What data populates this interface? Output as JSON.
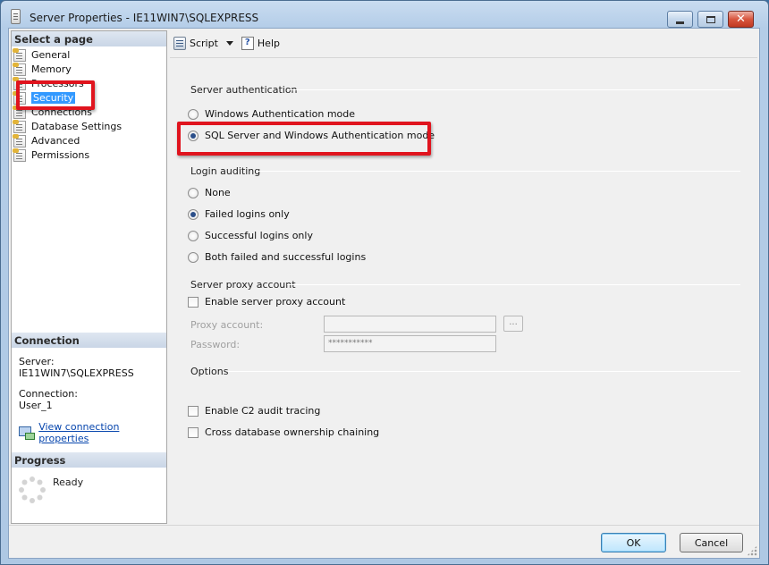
{
  "window": {
    "title": "Server Properties - IE11WIN7\\SQLEXPRESS"
  },
  "left_panel": {
    "select_page_header": "Select a page",
    "pages": [
      {
        "label": "General",
        "selected": false
      },
      {
        "label": "Memory",
        "selected": false
      },
      {
        "label": "Processors",
        "selected": false
      },
      {
        "label": "Security",
        "selected": true
      },
      {
        "label": "Connections",
        "selected": false
      },
      {
        "label": "Database Settings",
        "selected": false
      },
      {
        "label": "Advanced",
        "selected": false
      },
      {
        "label": "Permissions",
        "selected": false
      }
    ],
    "connection": {
      "header": "Connection",
      "server_label": "Server:",
      "server_value": "IE11WIN7\\SQLEXPRESS",
      "connection_label": "Connection:",
      "connection_value": "User_1",
      "link_text": "View connection properties"
    },
    "progress": {
      "header": "Progress",
      "status": "Ready"
    }
  },
  "toolbar": {
    "script_label": "Script",
    "help_label": "Help"
  },
  "server_authentication": {
    "header": "Server authentication",
    "options": [
      {
        "label": "Windows Authentication mode",
        "checked": false
      },
      {
        "label": "SQL Server and Windows Authentication mode",
        "checked": true
      }
    ]
  },
  "login_auditing": {
    "header": "Login auditing",
    "options": [
      {
        "label": "None",
        "checked": false
      },
      {
        "label": "Failed logins only",
        "checked": true
      },
      {
        "label": "Successful logins only",
        "checked": false
      },
      {
        "label": "Both failed and successful logins",
        "checked": false
      }
    ]
  },
  "server_proxy": {
    "header": "Server proxy account",
    "enable_label": "Enable server proxy account",
    "enable_checked": false,
    "proxy_account_label": "Proxy account:",
    "proxy_account_value": "",
    "password_label": "Password:",
    "password_value": "***********",
    "browse_label": "..."
  },
  "options": {
    "header": "Options",
    "c2_audit_label": "Enable C2 audit tracing",
    "c2_audit_checked": false,
    "cross_db_label": "Cross database ownership chaining",
    "cross_db_checked": false
  },
  "buttons": {
    "ok_label": "OK",
    "cancel_label": "Cancel"
  },
  "colors": {
    "highlight": "#e0141e",
    "selection": "#3399ff",
    "link": "#0645ad"
  }
}
